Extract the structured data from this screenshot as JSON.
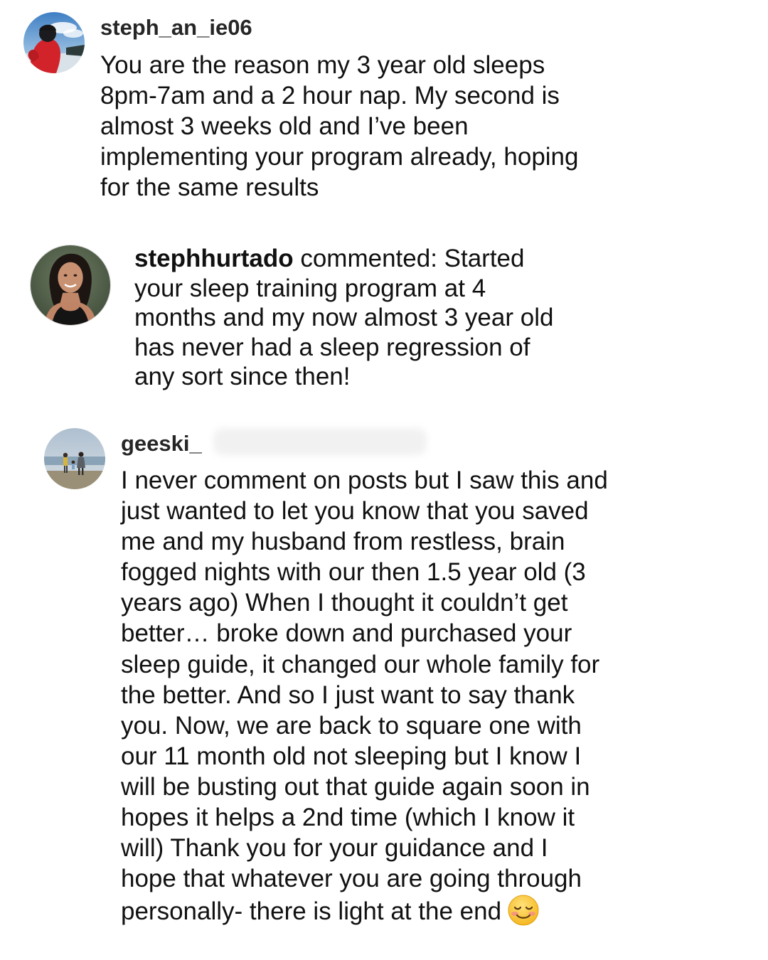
{
  "comments": [
    {
      "username": "steph_an_ie06",
      "text": "You are the reason my 3 year old sleeps\n8pm-7am and a 2 hour nap. My second is\nalmost 3 weeks old and I’ve been\nimplementing your program already, hoping\nfor the same results"
    },
    {
      "username": "stephhurtado",
      "prefix": " commented: Started",
      "text": "your sleep training program at 4\nmonths and my now almost 3 year old\nhas never had a sleep regression of\nany sort since then!"
    },
    {
      "username": "geeski_",
      "text": "I never comment on posts but I saw this and\njust wanted to let you know that you saved\nme and my husband from restless,  brain\nfogged nights with our then 1.5 year old (3\nyears ago) When I thought it couldn’t get\nbetter… broke down and purchased your\nsleep guide, it changed our whole family for\nthe better. And so I just want to say thank\nyou. Now, we are back to square one with\nour 11 month old not sleeping but I know I\nwill be busting out that guide again soon in\nhopes it helps a 2nd time (which I know it\nwill) Thank you for your guidance and I\nhope that whatever you are going through\npersonally- there is light at the end",
      "emoji": "smiling-face-emoji"
    }
  ],
  "icons": {
    "avatar_1": "profile-photo-red-jacket",
    "avatar_2": "profile-photo-woman",
    "avatar_3": "profile-photo-beach"
  }
}
